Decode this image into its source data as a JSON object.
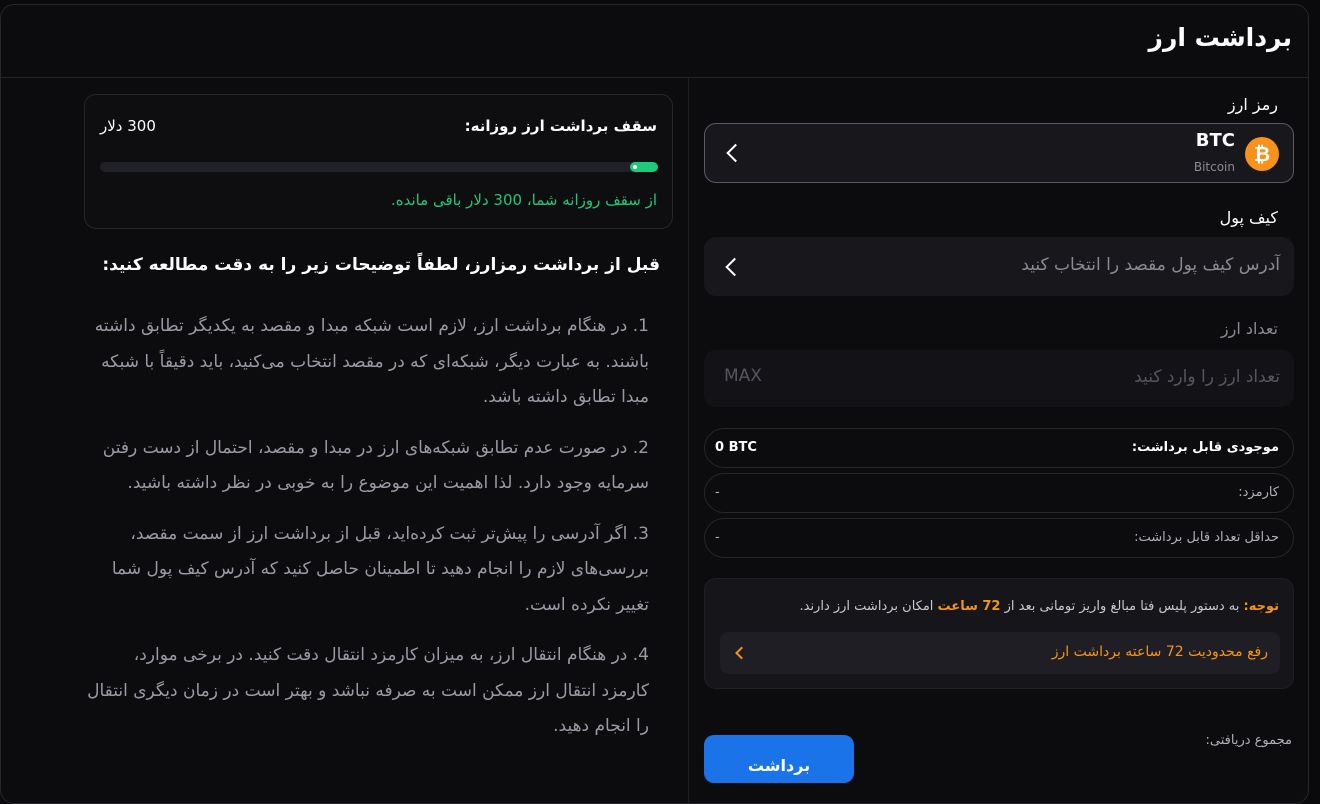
{
  "header": {
    "title": "برداشت ارز"
  },
  "form": {
    "coin_label": "رمز ارز",
    "coin": {
      "symbol": "BTC",
      "name": "Bitcoin",
      "logo_glyph": "₿",
      "logo_color": "#f7931a"
    },
    "wallet_label": "کیف پول",
    "wallet_placeholder": "آدرس کیف پول مقصد را انتخاب کنید",
    "amount_label": "تعداد ارز",
    "amount_placeholder": "تعداد ارز را وارد کنید",
    "max_label": "MAX",
    "info_rows": [
      {
        "key": "موجودی قابل برداشت:",
        "value": "0 BTC"
      },
      {
        "key": "کارمزد:",
        "value": "-"
      },
      {
        "key": "حداقل تعداد قابل برداشت:",
        "value": "-"
      }
    ],
    "notice": {
      "prefix": "توجه:",
      "before_hours": " به دستور پلیس فتا مبالغ واریز تومانی بعد از ",
      "hours": "72 ساعت",
      "after_hours": " امکان برداشت ارز دارند.",
      "link_text": "رفع محدودیت 72 ساعته برداشت ارز"
    },
    "total_label": "مجموع دریافتی:",
    "submit_label": "برداشت"
  },
  "limit": {
    "title": "سقف برداشت ارز روزانه:",
    "value": "300 دلار",
    "remaining_text": "از سقف روزانه شما، 300 دلار باقی مانده.",
    "progress_fraction": 0.05
  },
  "guide": {
    "title": "قبل از برداشت رمزارز، لطفاً توضیحات زیر را به دقت مطالعه کنید:",
    "items": [
      {
        "num": "1.",
        "text": "در هنگام برداشت ارز، لازم است شبکه مبدا و مقصد به یکدیگر تطابق داشته باشند. به عبارت دیگر، شبکه‌ای که در مقصد انتخاب می‌کنید، باید دقیقاً با شبکه مبدا تطابق داشته باشد."
      },
      {
        "num": "2.",
        "text": "در صورت عدم تطابق شبکه‌های ارز در مبدا و مقصد، احتمال از دست رفتن سرمایه وجود دارد. لذا اهمیت این موضوع را به خوبی در نظر داشته باشید."
      },
      {
        "num": "3.",
        "text": "اگر آدرسی را پیش‌تر ثبت کرده‌اید، قبل از برداشت ارز از سمت مقصد، بررسی‌های لازم را انجام دهید تا اطمینان حاصل کنید که آدرس کیف پول شما تغییر نکرده است."
      },
      {
        "num": "4.",
        "text": "در هنگام انتقال ارز، به میزان کارمزد انتقال دقت کنید. در برخی موارد، کارمزد انتقال ارز ممکن است به صرفه نباشد و بهتر است در زمان دیگری انتقال را انجام دهید."
      }
    ]
  }
}
